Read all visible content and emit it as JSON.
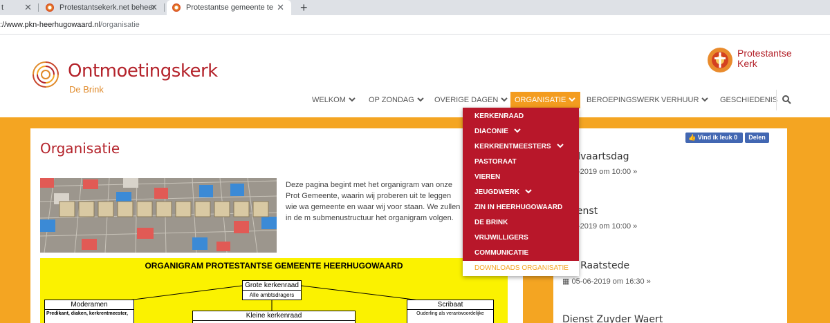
{
  "browser": {
    "tabs": [
      {
        "label": "t"
      },
      {
        "label": "Protestantsekerk.net beheer"
      },
      {
        "label": "Protestantse gemeente te Heerhugowaard"
      }
    ],
    "new_tab": "+",
    "url_host": "://www.pkn-heerhugowaard.nl",
    "url_path": "/organisatie"
  },
  "header": {
    "logo_title": "Ontmoetingskerk",
    "logo_sub": "De Brink",
    "pk_line1": "Protestantse",
    "pk_line2": "Kerk"
  },
  "nav": {
    "items": [
      {
        "label": "WELKOM"
      },
      {
        "label": "OP ZONDAG"
      },
      {
        "label": "OVERIGE DAGEN"
      },
      {
        "label": "ORGANISATIE"
      },
      {
        "label": "BEROEPINGSWERK"
      },
      {
        "label": "VERHUUR"
      },
      {
        "label": "GESCHIEDENIS"
      }
    ]
  },
  "dropdown": {
    "items": [
      {
        "label": "KERKENRAAD"
      },
      {
        "label": "DIACONIE"
      },
      {
        "label": "KERKRENTMEESTERS"
      },
      {
        "label": "PASTORAAT"
      },
      {
        "label": "VIEREN"
      },
      {
        "label": "JEUGDWERK"
      },
      {
        "label": "ZIN IN HEERHUGOWAARD"
      },
      {
        "label": "DE BRINK"
      },
      {
        "label": "VRIJWILLIGERS"
      },
      {
        "label": "COMMUNICATIE"
      },
      {
        "label": "DOWNLOADS ORGANISATIE"
      }
    ]
  },
  "content": {
    "title": "Organisatie",
    "intro": "Deze pagina begint met het organigram van onze Prot Gemeente, waarin wij proberen uit te leggen wie wa gemeente en waar wij voor staan. We zullen in de m submenustructuur het organigram volgen.",
    "scrabble_word": "ORGANISATIE",
    "organigram": {
      "title": "ORGANIGRAM PROTESTANTSE GEMEENTE HEERHUGOWAARD",
      "grote_kerkenraad": "Grote kerkenraad",
      "alle_ambtsdragers": "Alle ambtsdragers",
      "moderamen": "Moderamen",
      "moderamen_body": "Predikant, diaken, kerkrentmeester,",
      "kleine_kerkenraad": "Kleine kerkenraad",
      "scribaat": "Scribaat",
      "scribaat_body": "Ouderling als verantwoordelijke"
    }
  },
  "facebook": {
    "like": "Vind ik leuk 0",
    "share": "Delen"
  },
  "events": [
    {
      "title": "melvaartsdag",
      "date": "0-05-2019 om 10:00"
    },
    {
      "title": "kdienst",
      "date": "2-06-2019 om 10:00"
    },
    {
      "title": "nst Raatstede",
      "date": "05-06-2019 om 16:30"
    },
    {
      "title": "Dienst Zuyder Waert",
      "date": ""
    }
  ],
  "colors": {
    "brand_red": "#b4232b",
    "brand_orange": "#f4a522",
    "dropdown_red": "#b8172a"
  }
}
